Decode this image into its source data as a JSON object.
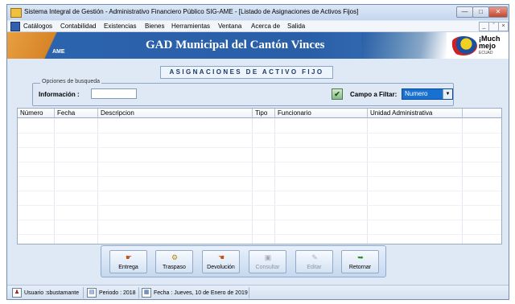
{
  "window": {
    "title": "Sistema Integral de Gestión - Administrativo Financiero Público SIG-AME - [Listado de Asignaciones de Activos Fijos]",
    "controls": {
      "minimize": "—",
      "maximize": "□",
      "close": "✕"
    }
  },
  "menu": {
    "items": [
      "Catálogos",
      "Contabilidad",
      "Existencias",
      "Bienes",
      "Herramientas",
      "Ventana",
      "Acerca de",
      "Salida"
    ],
    "mdi_controls": [
      "_",
      "ˇ",
      "×"
    ]
  },
  "banner": {
    "logo_text": "AME",
    "title": "GAD Municipal del Cantón Vinces",
    "brand": {
      "line1": "¡Much",
      "line2": "mejo",
      "line3": "ECUAD"
    }
  },
  "heading": "ASIGNACIONES DE ACTIVO FIJO",
  "search": {
    "legend": "Opciones de busqueda",
    "info_label": "Información :",
    "info_value": "",
    "filter_label": "Campo a Filtar:",
    "filter_value": "Numero",
    "check_icon": "check-icon"
  },
  "table": {
    "columns": [
      "Número",
      "Fecha",
      "Descripcion",
      "Tipo",
      "Funcionario",
      "Unidad Administrativa"
    ],
    "rows": []
  },
  "toolbar": [
    {
      "label": "Entrega",
      "icon": "hand-give-icon",
      "enabled": true
    },
    {
      "label": "Traspaso",
      "icon": "transfer-icon",
      "enabled": true
    },
    {
      "label": "Devolución",
      "icon": "return-icon",
      "enabled": true
    },
    {
      "label": "Consultar",
      "icon": "query-icon",
      "enabled": false
    },
    {
      "label": "Editar",
      "icon": "edit-icon",
      "enabled": false
    },
    {
      "label": "Retornar",
      "icon": "back-icon",
      "enabled": true
    }
  ],
  "status": {
    "user": "Usuario :sbustamante",
    "period": "Periodo : 2018",
    "date": "Fecha : Jueves, 10 de Enero de 2019"
  }
}
